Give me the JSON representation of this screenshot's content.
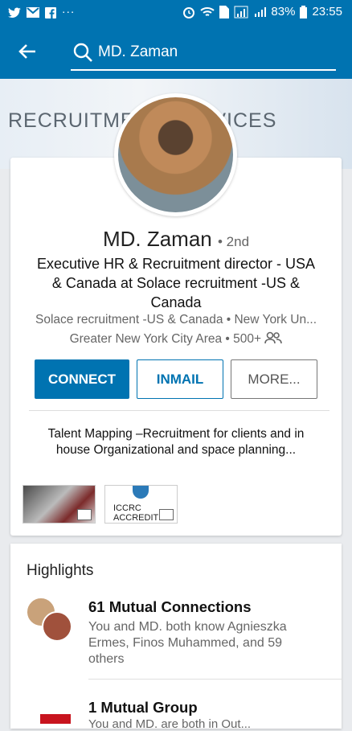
{
  "status_bar": {
    "left_icons": [
      "twitter-icon",
      "gmail-icon",
      "facebook-icon",
      "more-dots-icon"
    ],
    "battery": "83%",
    "time": "23:55"
  },
  "search": {
    "query": "MD. Zaman"
  },
  "cover": {
    "text": "RECRUITMENT SERVICES"
  },
  "profile": {
    "name": "MD. Zaman",
    "degree": "• 2nd",
    "headline": "Executive HR & Recruitment director - USA & Canada at Solace recruitment -US & Canada",
    "company_line": "Solace recruitment -US & Canada • New York Un...",
    "location_line": "Greater New York City Area • 500+"
  },
  "buttons": {
    "connect": "CONNECT",
    "inmail": "INMAIL",
    "more": "MORE..."
  },
  "summary": "Talent Mapping –Recruitment for clients and in house Organizational and space planning...",
  "media": [
    {
      "label": ""
    },
    {
      "label": "ICCRC ACCREDIT"
    }
  ],
  "highlights": {
    "title": "Highlights",
    "mutual_connections_title": "61 Mutual Connections",
    "mutual_connections_desc": "You and MD. both know Agnieszka Ermes, Finos Muhammed, and 59 others",
    "mutual_group_title": "1 Mutual Group",
    "mutual_group_desc": "You and MD. are both in Out..."
  },
  "colors": {
    "brand": "#0073b1"
  }
}
